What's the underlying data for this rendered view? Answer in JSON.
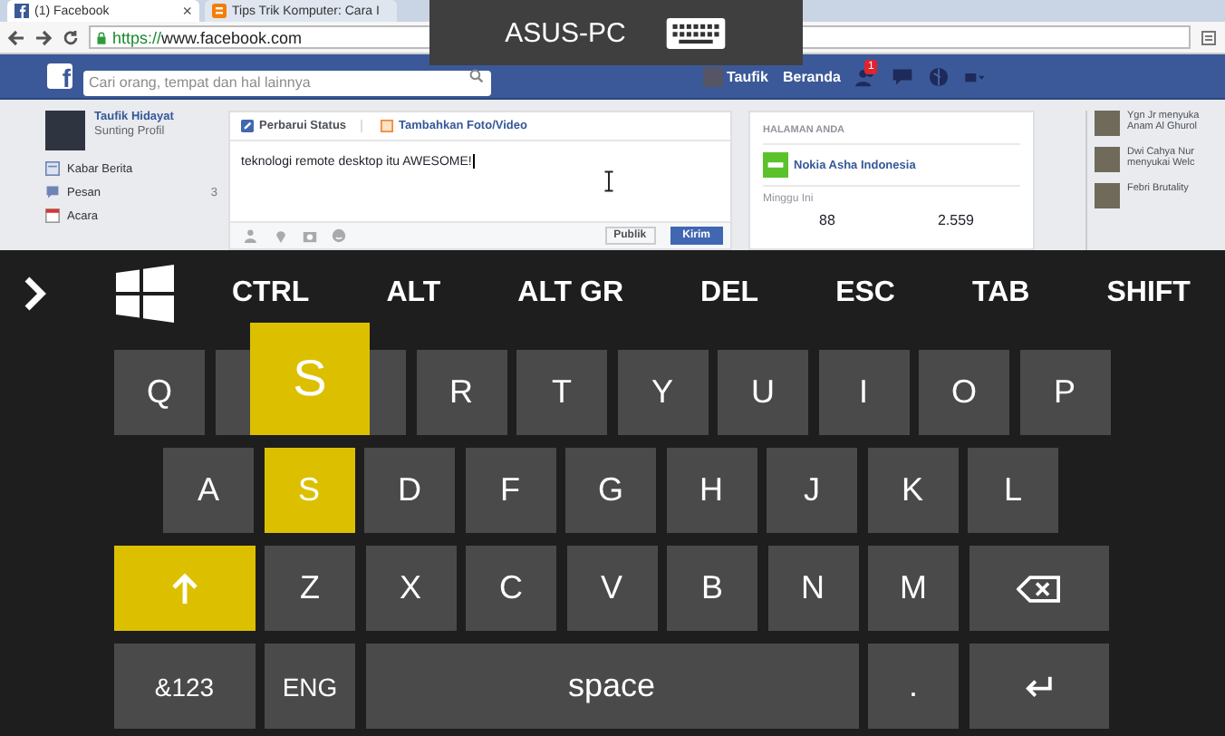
{
  "browser": {
    "tabs": [
      {
        "title": "(1) Facebook",
        "selected": true
      },
      {
        "title": "Tips Trik Komputer: Cara I",
        "selected": false
      }
    ],
    "close_label": "×",
    "url_scheme": "https://",
    "url_rest": "www.facebook.com"
  },
  "remote_banner": {
    "title": "ASUS-PC"
  },
  "facebook": {
    "logo": "f",
    "search_placeholder": "Cari orang, tempat dan hal lainnya",
    "user": "Taufik",
    "home": "Beranda",
    "notification_count": "1",
    "profile": {
      "name": "Taufik Hidayat",
      "edit": "Sunting Profil"
    },
    "nav": [
      {
        "label": "Kabar Berita"
      },
      {
        "label": "Pesan",
        "count": "3"
      },
      {
        "label": "Acara"
      }
    ],
    "composer": {
      "tabs": [
        {
          "label": "Perbarui Status",
          "selected": true
        },
        {
          "label": "Tambahkan Foto/Video",
          "selected": false
        }
      ],
      "text": "teknologi remote desktop itu AWESOME!",
      "privacy": "Publik",
      "submit": "Kirim"
    },
    "pages": {
      "heading": "HALAMAN ANDA",
      "page": "Nokia Asha Indonesia",
      "period": "Minggu Ini",
      "stats": [
        "88",
        "2.559"
      ]
    },
    "ticker": [
      {
        "line1": "Ygn Jr menyuka",
        "line2": "Anam Al Ghurol"
      },
      {
        "line1": "Dwi Cahya Nur",
        "line2": "menyukai Welc"
      },
      {
        "line1": "Febri Brutality"
      }
    ]
  },
  "keyboard": {
    "function_keys": [
      "CTRL",
      "ALT",
      "ALT GR",
      "DEL",
      "ESC",
      "TAB",
      "SHIFT"
    ],
    "preview": {
      "label": "S"
    },
    "rows": [
      {
        "keys": [
          {
            "kind": "char",
            "label": "Q",
            "pressed": false
          },
          {
            "kind": "covered",
            "pressed": false
          },
          {
            "kind": "covered",
            "pressed": false
          },
          {
            "kind": "char",
            "label": "R",
            "pressed": false
          },
          {
            "kind": "char",
            "label": "T",
            "pressed": false
          },
          {
            "kind": "char",
            "label": "Y",
            "pressed": false
          },
          {
            "kind": "char",
            "label": "U",
            "pressed": false
          },
          {
            "kind": "char",
            "label": "I",
            "pressed": false
          },
          {
            "kind": "char",
            "label": "O",
            "pressed": false
          },
          {
            "kind": "char",
            "label": "P",
            "pressed": false
          }
        ]
      },
      {
        "keys": [
          {
            "kind": "char",
            "label": "A",
            "pressed": false
          },
          {
            "kind": "char",
            "label": "S",
            "pressed": true
          },
          {
            "kind": "char",
            "label": "D",
            "pressed": false
          },
          {
            "kind": "char",
            "label": "F",
            "pressed": false
          },
          {
            "kind": "char",
            "label": "G",
            "pressed": false
          },
          {
            "kind": "char",
            "label": "H",
            "pressed": false
          },
          {
            "kind": "char",
            "label": "J",
            "pressed": false
          },
          {
            "kind": "char",
            "label": "K",
            "pressed": false
          },
          {
            "kind": "char",
            "label": "L",
            "pressed": false
          }
        ]
      },
      {
        "keys": [
          {
            "kind": "shift",
            "pressed": true
          },
          {
            "kind": "char",
            "label": "Z",
            "pressed": false
          },
          {
            "kind": "char",
            "label": "X",
            "pressed": false
          },
          {
            "kind": "char",
            "label": "C",
            "pressed": false
          },
          {
            "kind": "char",
            "label": "V",
            "pressed": false
          },
          {
            "kind": "char",
            "label": "B",
            "pressed": false
          },
          {
            "kind": "char",
            "label": "N",
            "pressed": false
          },
          {
            "kind": "char",
            "label": "M",
            "pressed": false
          },
          {
            "kind": "backspace",
            "pressed": false
          }
        ]
      },
      {
        "keys": [
          {
            "kind": "mode",
            "label": "&123",
            "pressed": false
          },
          {
            "kind": "small",
            "label": "ENG",
            "pressed": false
          },
          {
            "kind": "space",
            "label": "space",
            "pressed": false
          },
          {
            "kind": "char",
            "label": ".",
            "pressed": false
          },
          {
            "kind": "enter",
            "pressed": false
          }
        ]
      }
    ]
  }
}
